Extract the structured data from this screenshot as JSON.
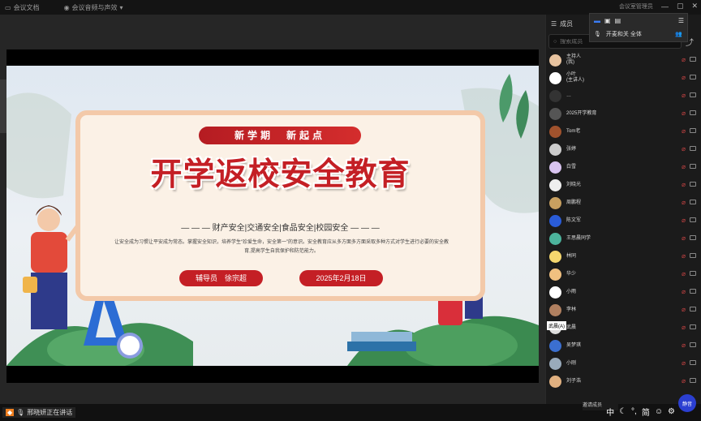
{
  "topbar": {
    "left_label": "会议文档",
    "mid_label": "会议音频与声效",
    "right_label": "会议室管理员",
    "window_icons": [
      "minimize-icon",
      "maximize-icon",
      "close-icon"
    ]
  },
  "slide": {
    "top_banner": "新学期　新起点",
    "title": "开学返校安全教育",
    "topics": "— — — 财产安全|交通安全|食品安全|校园安全 — — —",
    "description": "让安全成为习惯让平安成为常态。掌握安全知识，培养学生“珍爱生命，安全第一”的意识。安全教育应从多方面多方面采取多种方式对学生进行必要的安全教育,提高学生自我保护和防范能力。",
    "presenter": "辅导员　徐宗超",
    "date": "2025年2月18日"
  },
  "panel": {
    "tab_label": "成员",
    "popover_label": "开麦和关 全体",
    "search_placeholder": "搜索成员",
    "participants": [
      {
        "name": "主持人\n(我)",
        "color": "#e8c4a0"
      },
      {
        "name": "小叶\n(主讲人)",
        "color": "#ffffff"
      },
      {
        "name": "…",
        "color": "#333"
      },
      {
        "name": "2025开学教育",
        "color": "#555"
      },
      {
        "name": "Tom老",
        "color": "#a0522d"
      },
      {
        "name": "张婷",
        "color": "#ccc"
      },
      {
        "name": "白雪",
        "color": "#d9c4f0"
      },
      {
        "name": "刘晓光",
        "color": "#eee"
      },
      {
        "name": "周鹏程",
        "color": "#c8a060"
      },
      {
        "name": "陈文军",
        "color": "#2a5cd8"
      },
      {
        "name": "王思晨同学",
        "color": "#4cb39c"
      },
      {
        "name": "林同",
        "color": "#f5d76e"
      },
      {
        "name": "华少",
        "color": "#f0c080"
      },
      {
        "name": "小雨",
        "color": "#fff"
      },
      {
        "name": "李林",
        "color": "#b08060"
      },
      {
        "name": "武晨",
        "color": "#ddd"
      },
      {
        "name": "吴梦琪",
        "color": "#3b6fd0"
      },
      {
        "name": "小刚",
        "color": "#9ab"
      },
      {
        "name": "刘子浩",
        "color": "#e0b080"
      }
    ],
    "tooltip": "武晨(A)",
    "chat_placeholder": "邀请成员",
    "big_button": "静音"
  },
  "bottombar": {
    "user_tag": "邢晓妍正在讲话",
    "controls": [
      "中",
      "半角",
      "简",
      "表情",
      "设置"
    ]
  },
  "colors": {
    "accent_red": "#c41f25",
    "panel_bg": "#1b1b1b",
    "primary_button": "#2b3fd1"
  }
}
